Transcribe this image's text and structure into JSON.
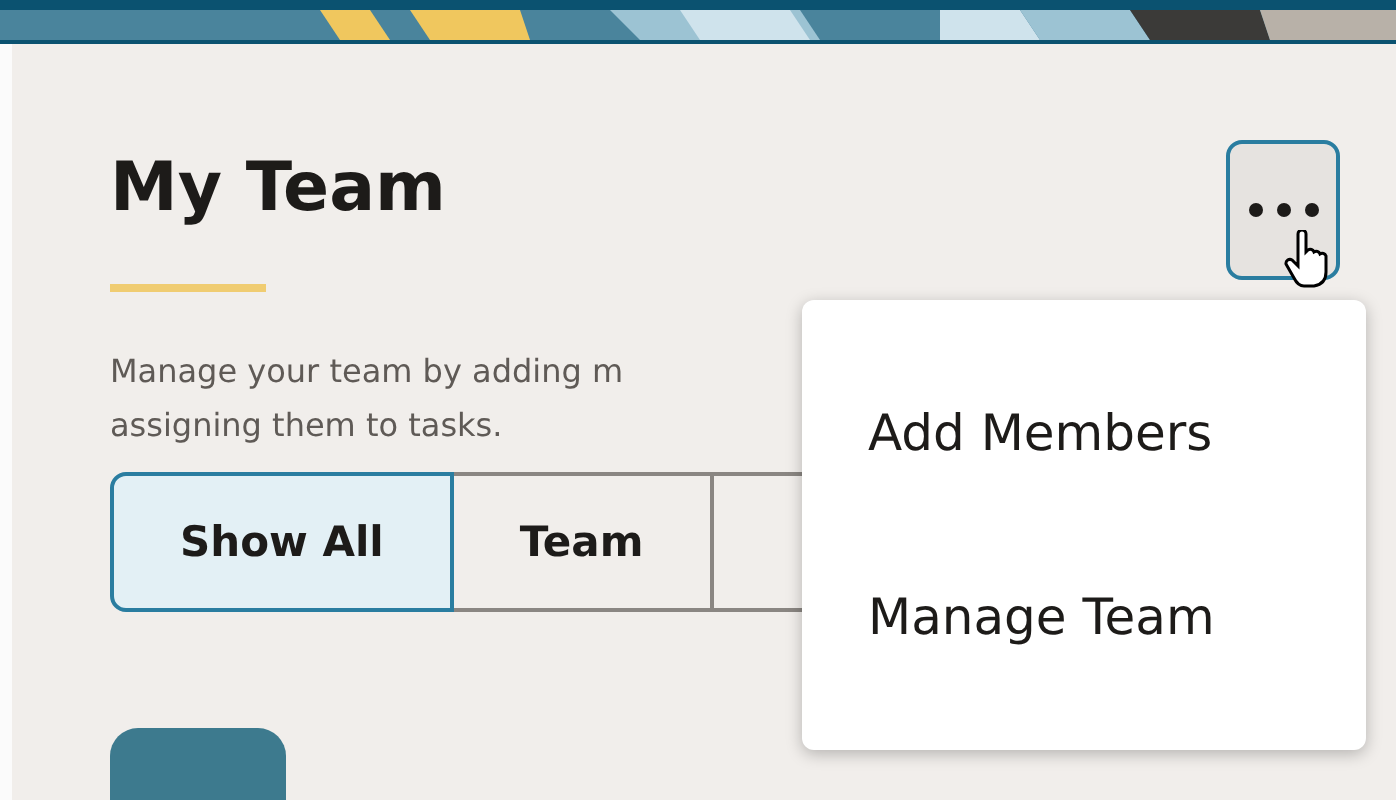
{
  "page": {
    "title": "My Team",
    "description_lines": [
      "Manage your team by adding m",
      "assigning them to tasks."
    ]
  },
  "filters": [
    {
      "label": "Show All",
      "selected": true
    },
    {
      "label": "Team",
      "selected": false
    }
  ],
  "menu": {
    "expanded": true,
    "items": [
      {
        "label": "Add Members"
      },
      {
        "label": "Manage Team"
      }
    ]
  }
}
